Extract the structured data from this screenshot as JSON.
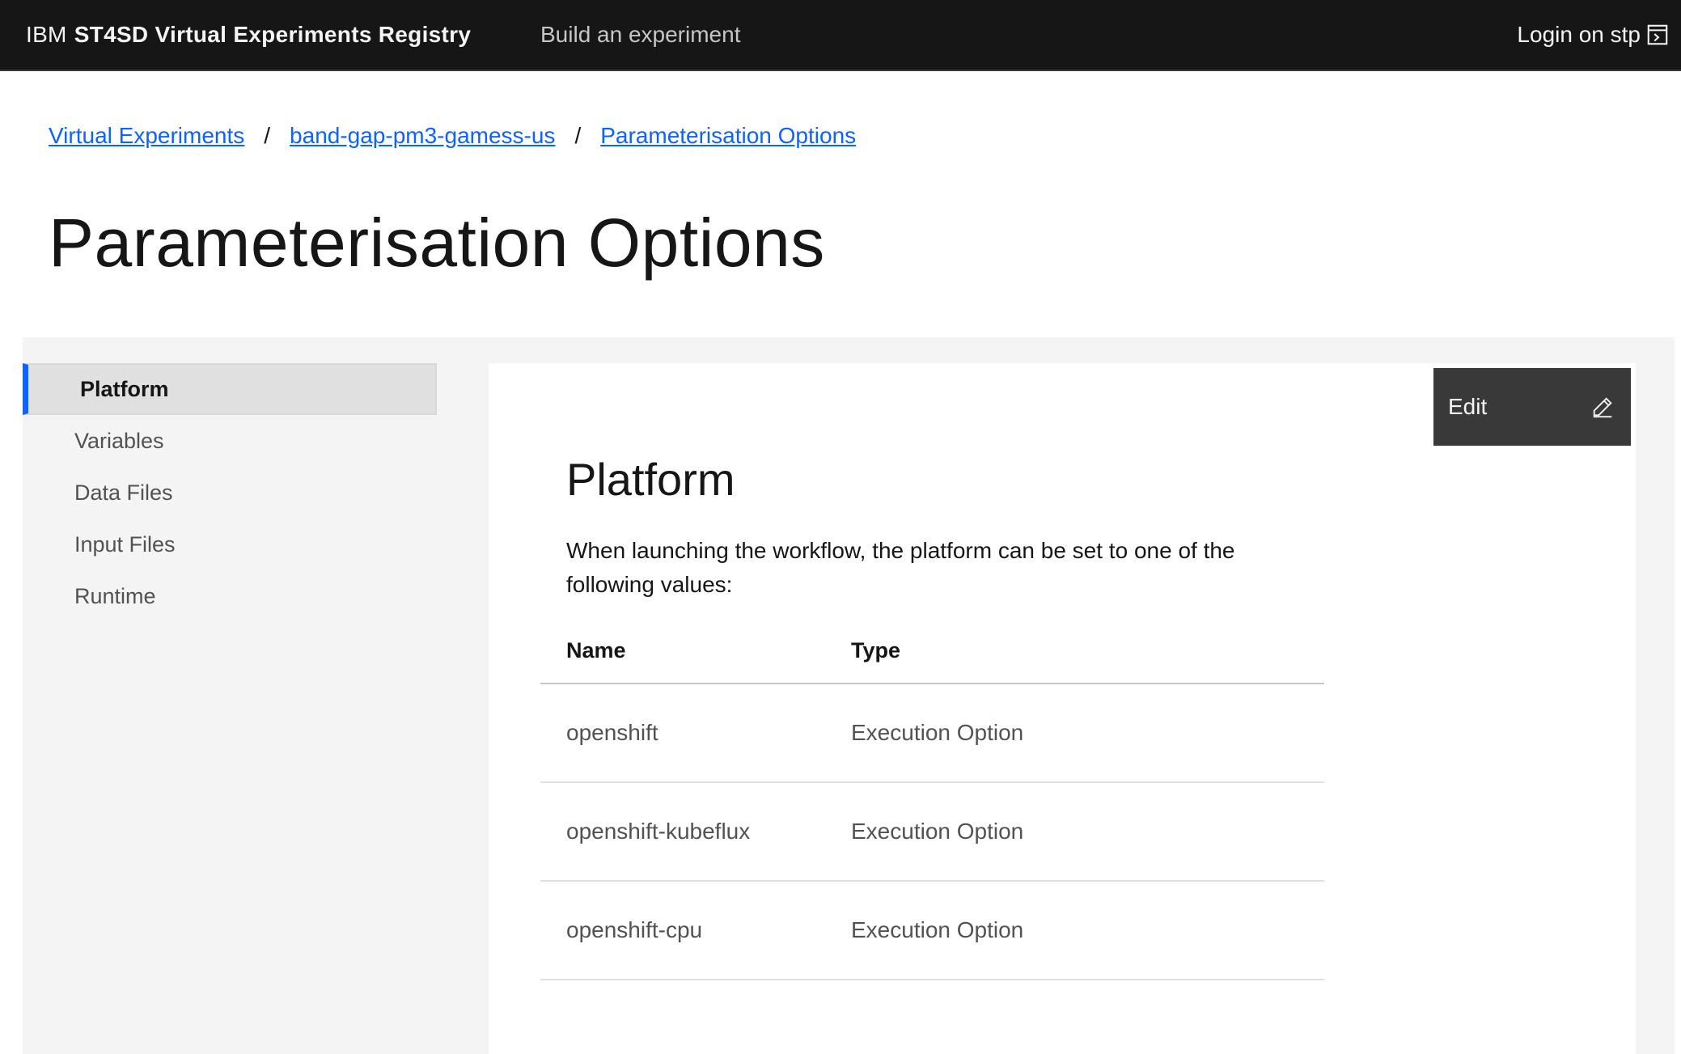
{
  "header": {
    "brand_prefix": "IBM",
    "brand_name": "ST4SD Virtual Experiments Registry",
    "nav_link": "Build an experiment",
    "login": "Login on stp"
  },
  "breadcrumb": [
    "Virtual Experiments",
    "band-gap-pm3-gamess-us",
    "Parameterisation Options"
  ],
  "breadcrumb_separator": "/",
  "page_title": "Parameterisation Options",
  "sidebar": {
    "items": [
      {
        "label": "Platform",
        "active": true
      },
      {
        "label": "Variables",
        "active": false
      },
      {
        "label": "Data Files",
        "active": false
      },
      {
        "label": "Input Files",
        "active": false
      },
      {
        "label": "Runtime",
        "active": false
      }
    ]
  },
  "edit_button": {
    "label": "Edit",
    "icon": "pencil-icon"
  },
  "section": {
    "title": "Platform",
    "description": "When launching the workflow, the platform can be set to one of the following values:",
    "table": {
      "headers": [
        "Name",
        "Type"
      ],
      "rows": [
        [
          "openshift",
          "Execution Option"
        ],
        [
          "openshift-kubeflux",
          "Execution Option"
        ],
        [
          "openshift-cpu",
          "Execution Option"
        ]
      ]
    }
  },
  "colors": {
    "header_bg": "#161616",
    "link": "#0f62fe",
    "active_indicator": "#0f62fe",
    "edit_button_bg": "#393939",
    "panel_bg": "#f4f4f4"
  }
}
